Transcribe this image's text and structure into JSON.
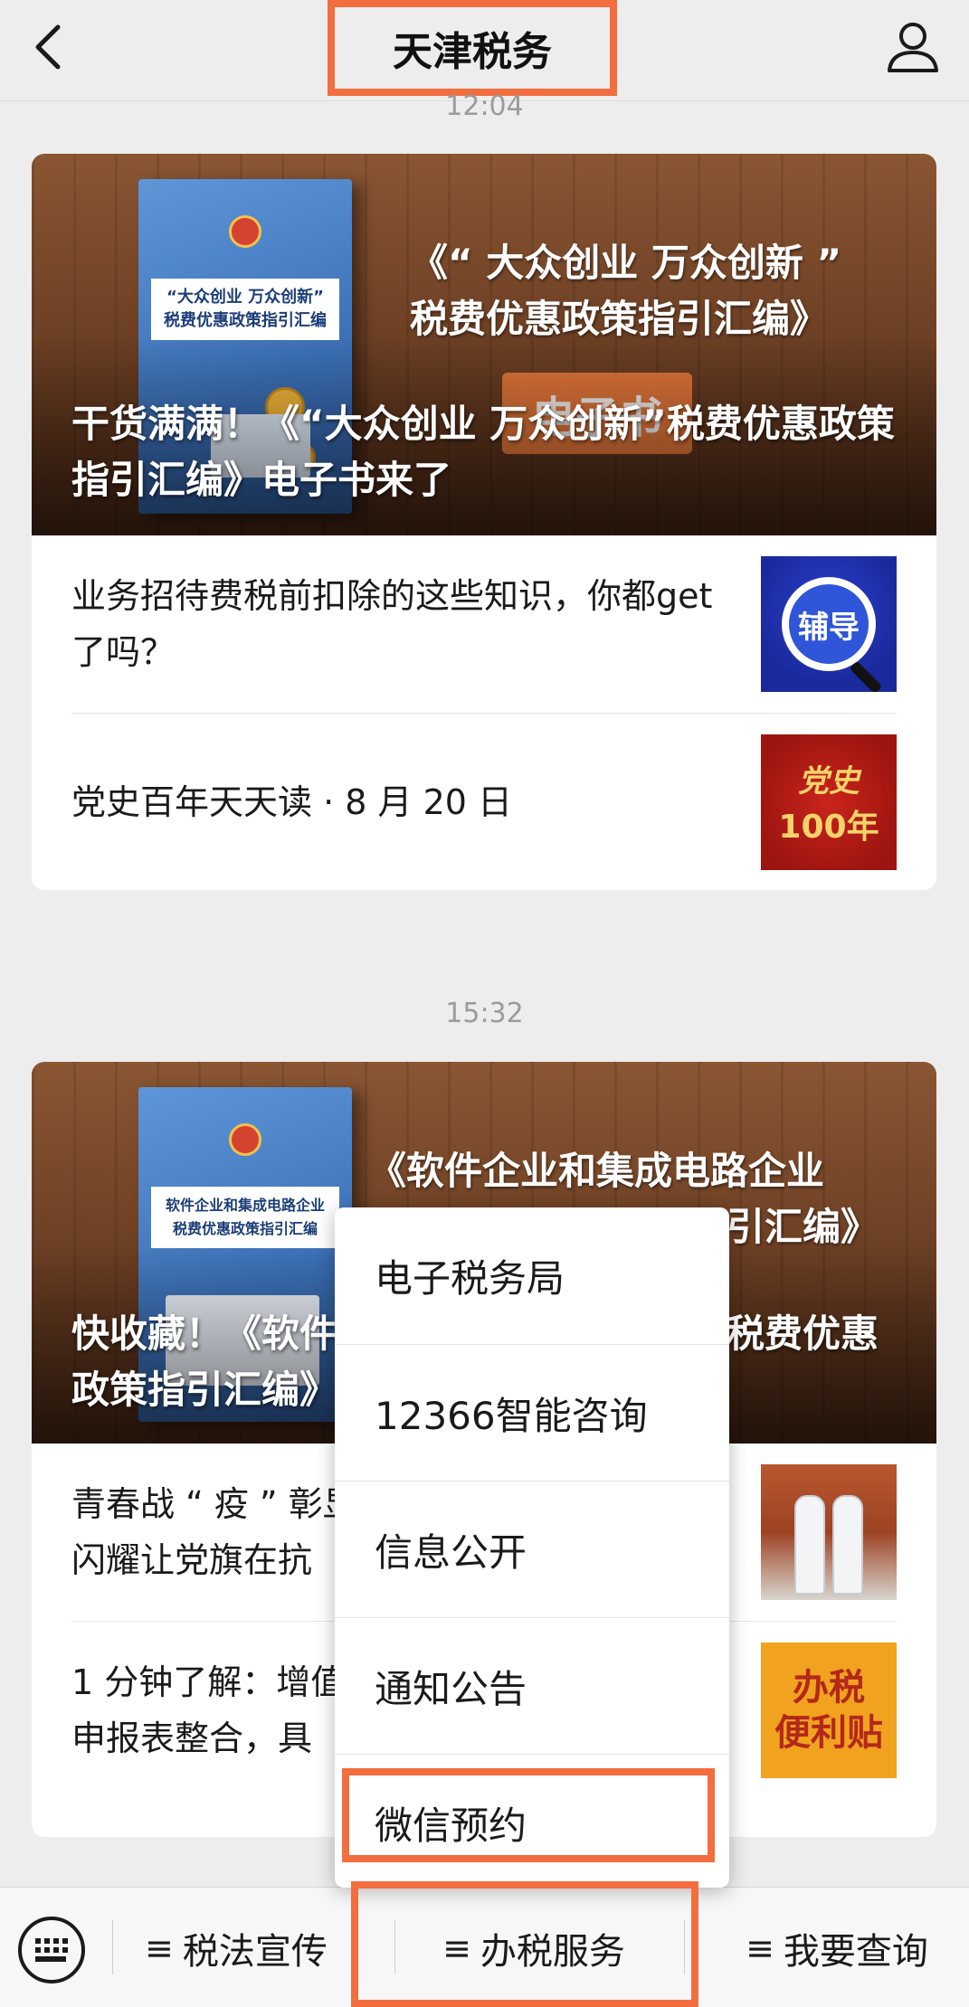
{
  "header": {
    "title": "天津税务",
    "back_icon": "chevron-left-icon",
    "profile_icon": "person-icon"
  },
  "timestamps": [
    "12:04",
    "15:32"
  ],
  "messages": [
    {
      "cover_subtitle_line1": "《“ 大众创业 万众创新 ”",
      "cover_subtitle_line2": "税费优惠政策指引汇编》",
      "book_title": "“大众创业 万众创新”\n税费优惠政策指引汇编",
      "badge": "电子书",
      "title": "干货满满！《“大众创业 万众创新”税费优惠政策指引汇编》电子书来了",
      "items": [
        {
          "text": "业务招待费税前扣除的这些知识，你都get 了吗？",
          "thumb_text": "辅导"
        },
        {
          "text": "党史百年天天读 · 8 月 20 日",
          "thumb_line1": "党史",
          "thumb_line2": "100年"
        }
      ]
    },
    {
      "cover_subtitle_line1": "《软件企业和集成电路企业",
      "cover_subtitle_line2": "引汇编》",
      "book_title": "软件企业和集成电路企业\n税费优惠政策指引汇编",
      "title_left": "快收藏！《软件",
      "title_right": "税费优惠",
      "title_line2": "政策指引汇编》",
      "items": [
        {
          "text_line1": "青春战 “ 疫 ” 彰显",
          "text_line2": "闪耀让党旗在抗"
        },
        {
          "text_line1": "1 分钟了解：增值",
          "text_line2": "申报表整合，具",
          "thumb_line1": "办税",
          "thumb_line2": "便利贴"
        }
      ]
    }
  ],
  "popup_menu": {
    "items": [
      "电子税务局",
      "12366智能咨询",
      "信息公开",
      "通知公告",
      "微信预约"
    ]
  },
  "bottom_bar": {
    "keyboard_icon": "keyboard-icon",
    "menus": [
      "税法宣传",
      "办税服务",
      "我要查询"
    ],
    "menu_prefix": "≡"
  },
  "colors": {
    "highlight": "#f36d3f",
    "background": "#ededed"
  }
}
